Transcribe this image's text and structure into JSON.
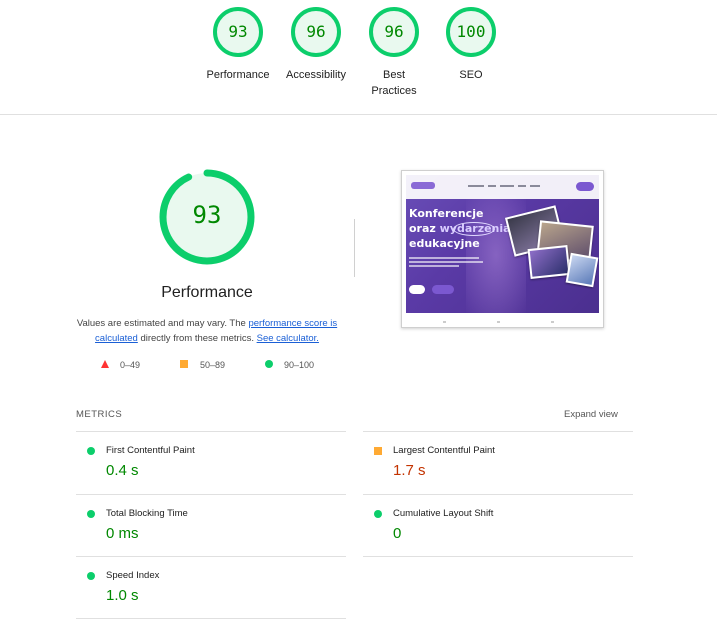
{
  "top_gauges": [
    {
      "score": 93,
      "label": "Performance"
    },
    {
      "score": 96,
      "label": "Accessibility"
    },
    {
      "score": 96,
      "label": "Best\nPractices"
    },
    {
      "score": 100,
      "label": "SEO"
    }
  ],
  "main": {
    "score": 93,
    "title": "Performance",
    "desc_pre": "Values are estimated and may vary. The ",
    "desc_link1": "performance score is calculated",
    "desc_mid": " directly from these metrics. ",
    "desc_link2": "See calculator.",
    "legend": [
      {
        "shape": "triangle",
        "range": "0–49",
        "color": "#ff3333"
      },
      {
        "shape": "square",
        "range": "50–89",
        "color": "#ffaa33"
      },
      {
        "shape": "circle",
        "range": "90–100",
        "color": "#0cce6b"
      }
    ]
  },
  "screenshot": {
    "heading_1": "Konferencje",
    "heading_2a": "oraz ",
    "heading_2b": "wydarzenia",
    "heading_3": "edukacyjne"
  },
  "metrics": {
    "header": "METRICS",
    "expand_label": "Expand view",
    "items": [
      {
        "name": "First Contentful Paint",
        "value": "0.4 s",
        "rating": "good"
      },
      {
        "name": "Largest Contentful Paint",
        "value": "1.7 s",
        "rating": "average"
      },
      {
        "name": "Total Blocking Time",
        "value": "0 ms",
        "rating": "good"
      },
      {
        "name": "Cumulative Layout Shift",
        "value": "0",
        "rating": "good"
      },
      {
        "name": "Speed Index",
        "value": "1.0 s",
        "rating": "good"
      }
    ]
  },
  "colors": {
    "good": "#0cce6b",
    "good_text": "#008800",
    "average": "#ffaa33",
    "average_text": "#c33300",
    "poor": "#ff3333"
  }
}
